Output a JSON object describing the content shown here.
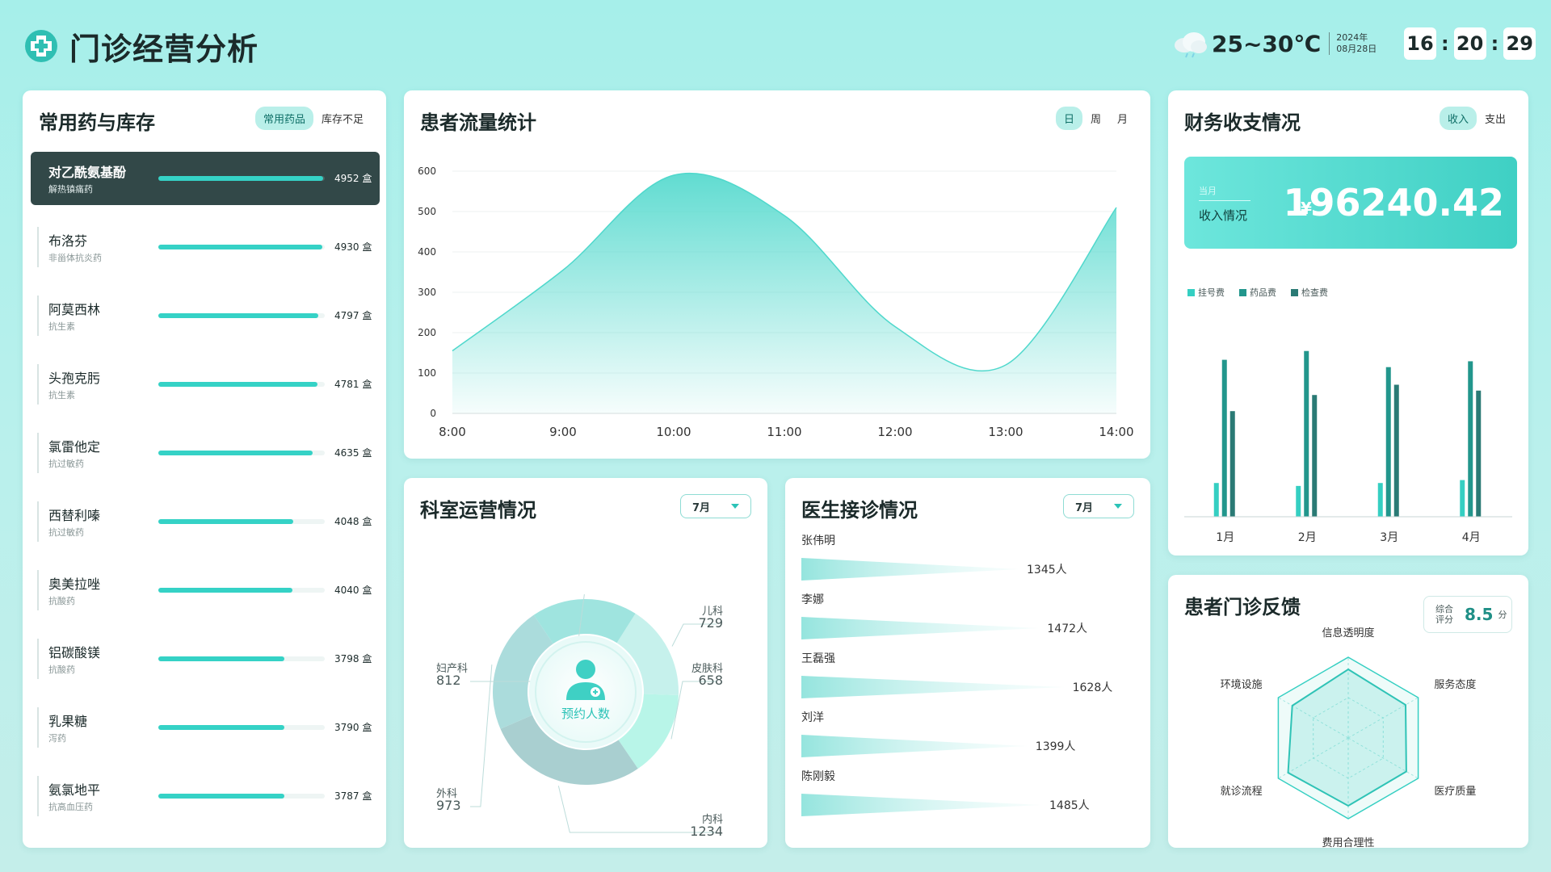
{
  "header": {
    "title": "门诊经营分析",
    "temperature": "25~30℃",
    "year": "2024年",
    "date": "08月28日",
    "clock": {
      "hour": "16",
      "minute": "20",
      "second": "29"
    },
    "icons": [
      "hospital-cross-icon",
      "cloud-rain-icon"
    ]
  },
  "medicine": {
    "title": "常用药与库存",
    "tabs": [
      "常用药品",
      "库存不足"
    ],
    "active_tab": "常用药品",
    "unit": "盒",
    "max": 5000,
    "items": [
      {
        "name": "对乙酰氨基酚",
        "category": "解热镇痛药",
        "count": 4952
      },
      {
        "name": "布洛芬",
        "category": "非甾体抗炎药",
        "count": 4930
      },
      {
        "name": "阿莫西林",
        "category": "抗生素",
        "count": 4797
      },
      {
        "name": "头孢克肟",
        "category": "抗生素",
        "count": 4781
      },
      {
        "name": "氯雷他定",
        "category": "抗过敏药",
        "count": 4635
      },
      {
        "name": "西替利嗪",
        "category": "抗过敏药",
        "count": 4048
      },
      {
        "name": "奥美拉唑",
        "category": "抗酸药",
        "count": 4040
      },
      {
        "name": "铝碳酸镁",
        "category": "抗酸药",
        "count": 3798
      },
      {
        "name": "乳果糖",
        "category": "泻药",
        "count": 3790
      },
      {
        "name": "氨氯地平",
        "category": "抗高血压药",
        "count": 3787
      }
    ]
  },
  "patient_flow": {
    "title": "患者流量统计",
    "tabs": [
      "日",
      "周",
      "月"
    ],
    "active_tab": "日",
    "chart_data": {
      "type": "area",
      "x": [
        "8:00",
        "9:00",
        "10:00",
        "11:00",
        "12:00",
        "13:00",
        "14:00"
      ],
      "y": [
        155,
        355,
        590,
        490,
        215,
        120,
        510
      ],
      "yticks": [
        0,
        100,
        200,
        300,
        400,
        500,
        600
      ],
      "ylim": [
        0,
        600
      ],
      "color": "#4fd8cc"
    }
  },
  "finance": {
    "title": "财务收支情况",
    "tabs": [
      "收入",
      "支出"
    ],
    "active_tab": "收入",
    "period_label": "当月",
    "income_label": "收入情况",
    "currency": "¥",
    "income_value": "196240.42",
    "chart_data": {
      "type": "bar",
      "categories": [
        "1月",
        "2月",
        "3月",
        "4月"
      ],
      "series": [
        {
          "name": "挂号费",
          "values": [
            23,
            21,
            23,
            25
          ],
          "color": "#35cfc2"
        },
        {
          "name": "药品费",
          "values": [
            107,
            113,
            102,
            106
          ],
          "color": "#22968c"
        },
        {
          "name": "检查费",
          "values": [
            72,
            83,
            90,
            86
          ],
          "color": "#2a7a75"
        }
      ],
      "ylim": [
        0,
        120
      ]
    }
  },
  "department": {
    "title": "科室运营情况",
    "month": "7月",
    "center_label": "预约人数",
    "chart_data": {
      "type": "pie",
      "slices": [
        {
          "label": "儿科",
          "value": 729,
          "color": "#c6f1ec"
        },
        {
          "label": "皮肤科",
          "value": 658,
          "color": "#b8f5e8"
        },
        {
          "label": "内科",
          "value": 1234,
          "color": "#a9cfd0"
        },
        {
          "label": "外科",
          "value": 973,
          "color": "#abdcdc"
        },
        {
          "label": "妇产科",
          "value": 812,
          "color": "#9fe4df"
        }
      ]
    }
  },
  "doctors": {
    "title": "医生接诊情况",
    "month": "7月",
    "unit": "人",
    "max": 1650,
    "items": [
      {
        "name": "张伟明",
        "count": 1345
      },
      {
        "name": "李娜",
        "count": 1472
      },
      {
        "name": "王磊强",
        "count": 1628
      },
      {
        "name": "刘洋",
        "count": 1399
      },
      {
        "name": "陈刚毅",
        "count": 1485
      }
    ]
  },
  "feedback": {
    "title": "患者门诊反馈",
    "score_label": "综合评分",
    "score_value": "8.5",
    "score_unit": "分",
    "chart_data": {
      "type": "radar",
      "axes": [
        "信息透明度",
        "服务态度",
        "医疗质量",
        "费用合理性",
        "就诊流程",
        "环境设施"
      ],
      "values": [
        8.5,
        8.2,
        8.3,
        8.4,
        8.6,
        8.0
      ],
      "max": 10
    }
  }
}
